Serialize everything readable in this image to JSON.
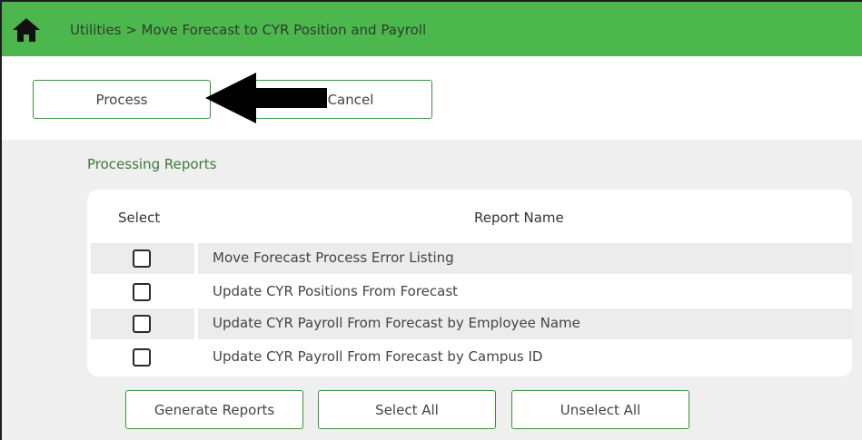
{
  "header": {
    "breadcrumb": "Utilities > Move Forecast to CYR Position and Payroll",
    "icon": "home-icon"
  },
  "toolbar": {
    "process_label": "Process",
    "cancel_label": "Cancel"
  },
  "reports": {
    "section_title": "Processing Reports",
    "columns": {
      "select": "Select",
      "name": "Report Name"
    },
    "rows": [
      {
        "label": "Move Forecast Process Error Listing",
        "checked": false
      },
      {
        "label": "Update CYR Positions From Forecast",
        "checked": false
      },
      {
        "label": "Update CYR Payroll From Forecast by Employee Name",
        "checked": false
      },
      {
        "label": "Update CYR Payroll From Forecast by Campus ID",
        "checked": false
      }
    ]
  },
  "actions": {
    "generate_label": "Generate Reports",
    "select_all_label": "Select All",
    "unselect_all_label": "Unselect All"
  },
  "colors": {
    "header_green": "#4cb74c",
    "button_border": "#3f8f3f",
    "section_title": "#3a7a3a",
    "background_gray": "#efefef"
  }
}
